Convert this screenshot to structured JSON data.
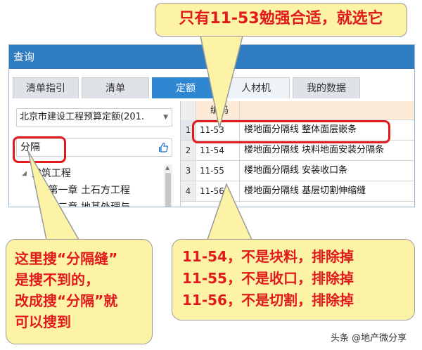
{
  "window": {
    "title": "查询"
  },
  "tabs": [
    {
      "label": "清单指引"
    },
    {
      "label": "清单"
    },
    {
      "label": "定额"
    },
    {
      "label": "人材机"
    },
    {
      "label": "我的数据"
    }
  ],
  "left_panel": {
    "quota_library": "北京市建设工程预算定额(201.",
    "search_value": "分隔",
    "tree": [
      {
        "label": "建筑工程",
        "level": 0,
        "expanded": true
      },
      {
        "label": "第一章 土石方工程",
        "level": 1,
        "expanded": false
      },
      {
        "label": "第二章 地基处理与...",
        "level": 1,
        "expanded": false
      }
    ]
  },
  "result_grid": {
    "headers": {
      "code": "编码"
    },
    "rows": [
      {
        "index": "1",
        "code": "11-53",
        "name": "楼地面分隔线 整体面层嵌条",
        "selected": true
      },
      {
        "index": "2",
        "code": "11-54",
        "name": "楼地面分隔线 块料地面安装分隔条",
        "selected": false
      },
      {
        "index": "3",
        "code": "11-55",
        "name": "楼地面分隔线 安装收口条",
        "selected": false
      },
      {
        "index": "4",
        "code": "11-56",
        "name": "楼地面分隔线 基层切割伸缩缝",
        "selected": false
      }
    ]
  },
  "annotations": {
    "top": "只有11-53勉强合适，就选它",
    "left": [
      "这里搜“分隔缝”",
      "是搜不到的，",
      "改成搜“分隔”就",
      "可以搜到"
    ],
    "right": [
      "11-54，不是块料，排除掉",
      "11-55，不是收口，排除掉",
      "11-56，不是切割，排除掉"
    ]
  },
  "watermark": "头条 @地产微分享",
  "colors": {
    "accent": "#2f7cc0",
    "active_tab": "#2f86d1",
    "highlight": "#e11b1b",
    "callout_bg": "#fdf3a7",
    "header_bg": "#fdebd8"
  }
}
